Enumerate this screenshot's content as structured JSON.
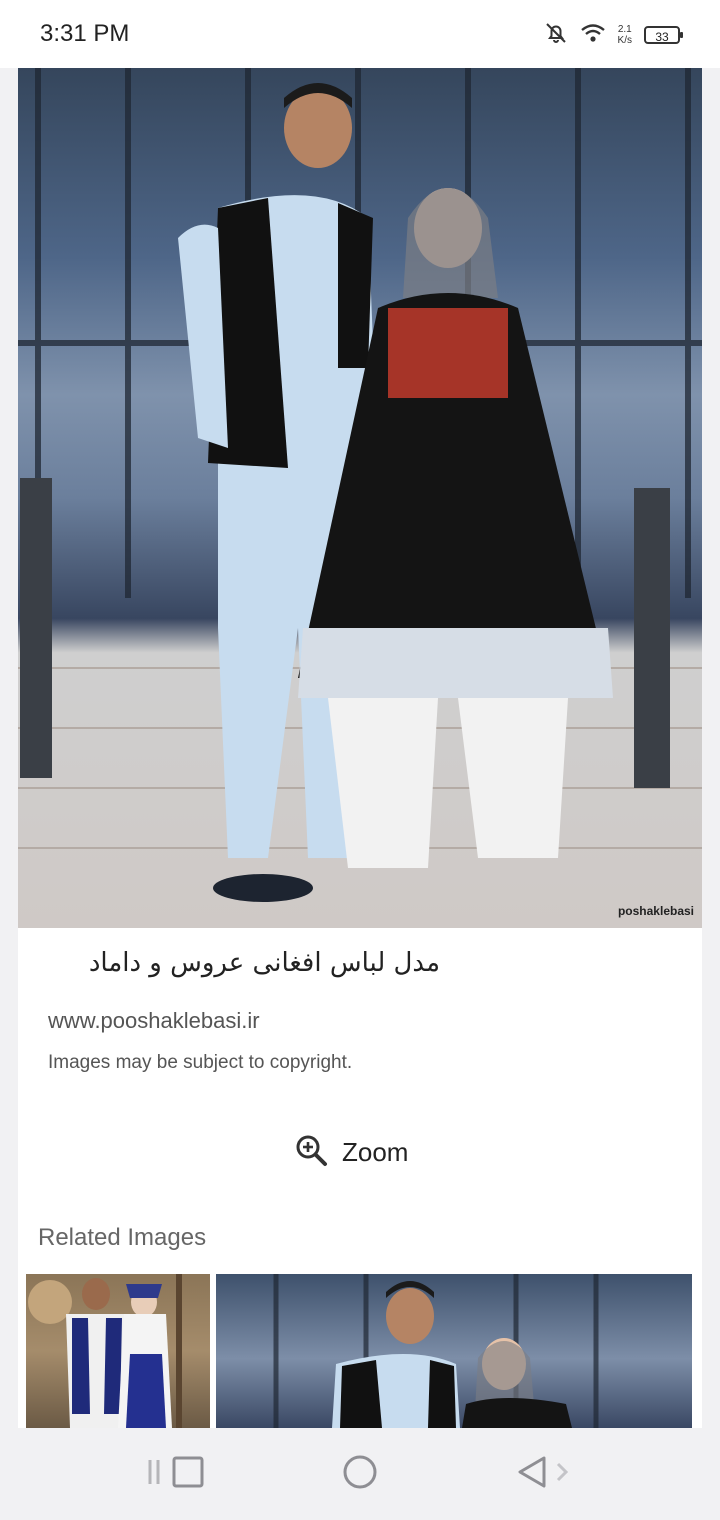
{
  "status_bar": {
    "time": "3:31 PM",
    "net_speed_value": "2.1",
    "net_speed_unit": "K/s",
    "battery_level": "33",
    "icons": [
      "bell-off-icon",
      "wifi-icon",
      "battery-icon"
    ]
  },
  "image_viewer": {
    "watermark": "poshaklebasi",
    "title": "مدل لباس افغانی عروس و داماد",
    "source_url": "www.pooshaklebasi.ir",
    "copyright_notice": "Images may be subject to copyright.",
    "zoom_label": "Zoom"
  },
  "related": {
    "heading": "Related Images",
    "thumbnails": [
      "related-image-1",
      "related-image-2"
    ]
  },
  "nav_bar": {
    "items": [
      "recents-button",
      "home-button",
      "back-button"
    ]
  }
}
